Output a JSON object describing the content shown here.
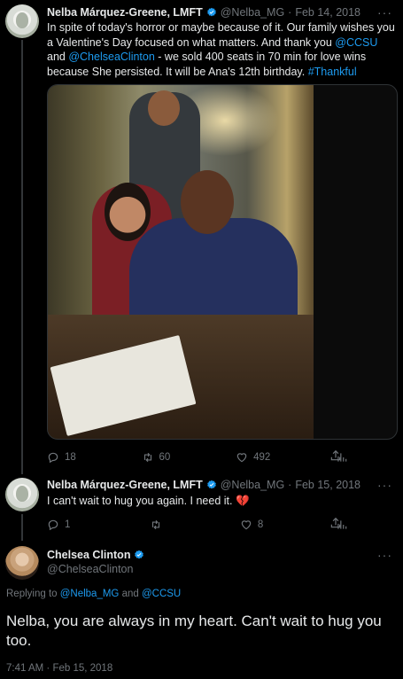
{
  "tweet1": {
    "name": "Nelba Márquez-Greene, LMFT",
    "handle": "@Nelba_MG",
    "sep": "·",
    "date": "Feb 14, 2018",
    "more": "···",
    "text_1": "In spite of today's horror or maybe because of it.  Our family wishes you a Valentine's Day focused on what matters.  And thank you ",
    "mention_ccsu": "@CCSU",
    "text_2": " and ",
    "mention_chelsea": "@ChelseaClinton",
    "text_3": " - we sold 400 seats in 70 min for love wins because She persisted. It will be Ana's 12th birthday. ",
    "hashtag": "#Thankful",
    "replies": "18",
    "retweets": "60",
    "likes": "492",
    "views": ""
  },
  "tweet2": {
    "name": "Nelba Márquez-Greene, LMFT",
    "handle": "@Nelba_MG",
    "sep": "·",
    "date": "Feb 15, 2018",
    "more": "···",
    "text": "I can't wait to hug you again.  I need it. ",
    "emoji": "💔",
    "replies": "1",
    "retweets": "",
    "likes": "8",
    "views": ""
  },
  "tweet3": {
    "name": "Chelsea Clinton",
    "handle": "@ChelseaClinton",
    "more": "···",
    "replying_prefix": "Replying to ",
    "replying_user1": "@Nelba_MG",
    "replying_and": " and ",
    "replying_user2": "@CCSU",
    "text": "Nelba, you are always in my heart. Can't wait to hug you too.",
    "time": "7:41 AM",
    "sep": " · ",
    "date": "Feb 15, 2018"
  },
  "colors": {
    "background": "#000000",
    "text": "#e7e9ea",
    "muted": "#71767b",
    "link": "#1d9bf0",
    "verified": "#1d9bf0",
    "heart_emoji": "#e0245e"
  },
  "icons": [
    "verified-icon",
    "reply-icon",
    "retweet-icon",
    "like-icon",
    "views-icon",
    "share-icon",
    "more-icon"
  ]
}
